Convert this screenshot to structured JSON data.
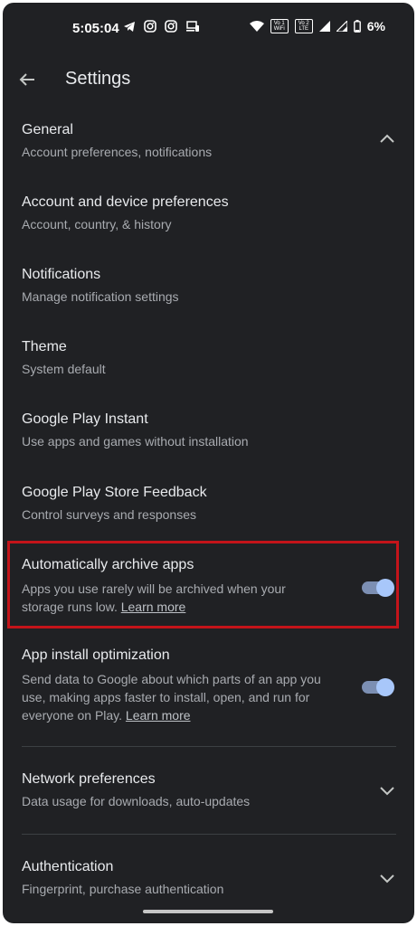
{
  "status_bar": {
    "time": "5:05:04",
    "sim1_badge": "Vo 1 WiFi",
    "sim2_badge": "Vo 2 LTE",
    "battery": "6%",
    "icons": [
      "telegram-icon",
      "instagram-icon",
      "instagram-icon",
      "cast-icon",
      "wifi-icon",
      "signal-icon",
      "signal-icon",
      "battery-icon"
    ]
  },
  "header": {
    "title": "Settings"
  },
  "settings": {
    "general": {
      "title": "General",
      "subtitle": "Account preferences, notifications",
      "expanded": true
    },
    "account": {
      "title": "Account and device preferences",
      "subtitle": "Account, country, & history"
    },
    "notifications": {
      "title": "Notifications",
      "subtitle": "Manage notification settings"
    },
    "theme": {
      "title": "Theme",
      "subtitle": "System default"
    },
    "instant": {
      "title": "Google Play Instant",
      "subtitle": "Use apps and games without installation"
    },
    "feedback": {
      "title": "Google Play Store Feedback",
      "subtitle": "Control surveys and responses"
    },
    "archive": {
      "title": "Automatically archive apps",
      "desc": "Apps you use rarely will be archived when your storage runs low.",
      "link": "Learn more",
      "enabled": true
    },
    "optimization": {
      "title": "App install optimization",
      "desc": "Send data to Google about which parts of an app you use, making apps faster to install, open, and run for everyone on Play.",
      "link": "Learn more",
      "enabled": true
    },
    "network": {
      "title": "Network preferences",
      "subtitle": "Data usage for downloads, auto-updates"
    },
    "authentication": {
      "title": "Authentication",
      "subtitle": "Fingerprint, purchase authentication"
    }
  },
  "colors": {
    "background": "#202124",
    "toggle_on": "#a8c7fa",
    "highlight": "#c4141a"
  }
}
